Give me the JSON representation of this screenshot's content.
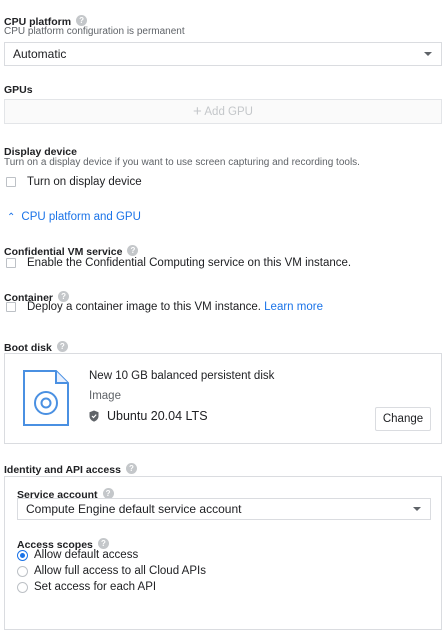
{
  "cpu_platform": {
    "title": "CPU platform",
    "subtitle": "CPU platform configuration is permanent",
    "selected": "Automatic"
  },
  "gpus": {
    "title": "GPUs",
    "add_label": "Add GPU"
  },
  "display_device": {
    "title": "Display device",
    "subtitle": "Turn on a display device if you want to use screen capturing and recording tools.",
    "checkbox_label": "Turn on display device"
  },
  "collapse_link": "CPU platform and GPU",
  "confidential_vm": {
    "title": "Confidential VM service",
    "checkbox_label": "Enable the Confidential Computing service on this VM instance."
  },
  "container": {
    "title": "Container",
    "checkbox_label": "Deploy a container image to this VM instance.",
    "learn_more": "Learn more"
  },
  "boot_disk": {
    "title": "Boot disk",
    "disk_name": "New 10 GB balanced persistent disk",
    "image_label": "Image",
    "image_name": "Ubuntu 20.04 LTS",
    "change_button": "Change"
  },
  "identity": {
    "title": "Identity and API access",
    "service_account_label": "Service account",
    "service_account_value": "Compute Engine default service account",
    "access_scopes_label": "Access scopes",
    "scopes": [
      "Allow default access",
      "Allow full access to all Cloud APIs",
      "Set access for each API"
    ]
  },
  "colors": {
    "accent": "#1a73e8",
    "border": "#dadce0",
    "muted": "#5f6368"
  }
}
